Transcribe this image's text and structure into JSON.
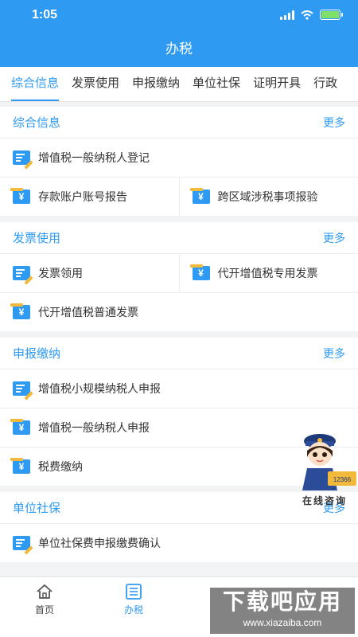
{
  "status_bar": {
    "time": "1:05"
  },
  "header": {
    "title": "办税"
  },
  "tabs": [
    {
      "label": "综合信息",
      "active": true
    },
    {
      "label": "发票使用"
    },
    {
      "label": "申报缴纳"
    },
    {
      "label": "单位社保"
    },
    {
      "label": "证明开具"
    },
    {
      "label": "行政"
    }
  ],
  "sections": {
    "general": {
      "title": "综合信息",
      "more": "更多",
      "items": [
        "增值税一般纳税人登记",
        "存款账户账号报告",
        "跨区域涉税事项报验"
      ]
    },
    "invoice": {
      "title": "发票使用",
      "more": "更多",
      "items": [
        "发票领用",
        "代开增值税专用发票",
        "代开增值税普通发票"
      ]
    },
    "declare": {
      "title": "申报缴纳",
      "more": "更多",
      "items": [
        "增值税小规模纳税人申报",
        "增值税一般纳税人申报",
        "税费缴纳"
      ]
    },
    "social": {
      "title": "单位社保",
      "more": "更多",
      "items": [
        "单位社保费申报缴费确认"
      ]
    }
  },
  "mascot": {
    "label": "在线咨询",
    "badge": "12366"
  },
  "tabbar": [
    {
      "label": "首页",
      "icon": "home-icon"
    },
    {
      "label": "办税",
      "icon": "list-icon",
      "active": true
    }
  ],
  "watermark": {
    "title": "下载吧应用",
    "url": "www.xiazaiba.com"
  },
  "colors": {
    "accent": "#2e9af2",
    "icon_orange": "#f2b93b"
  }
}
